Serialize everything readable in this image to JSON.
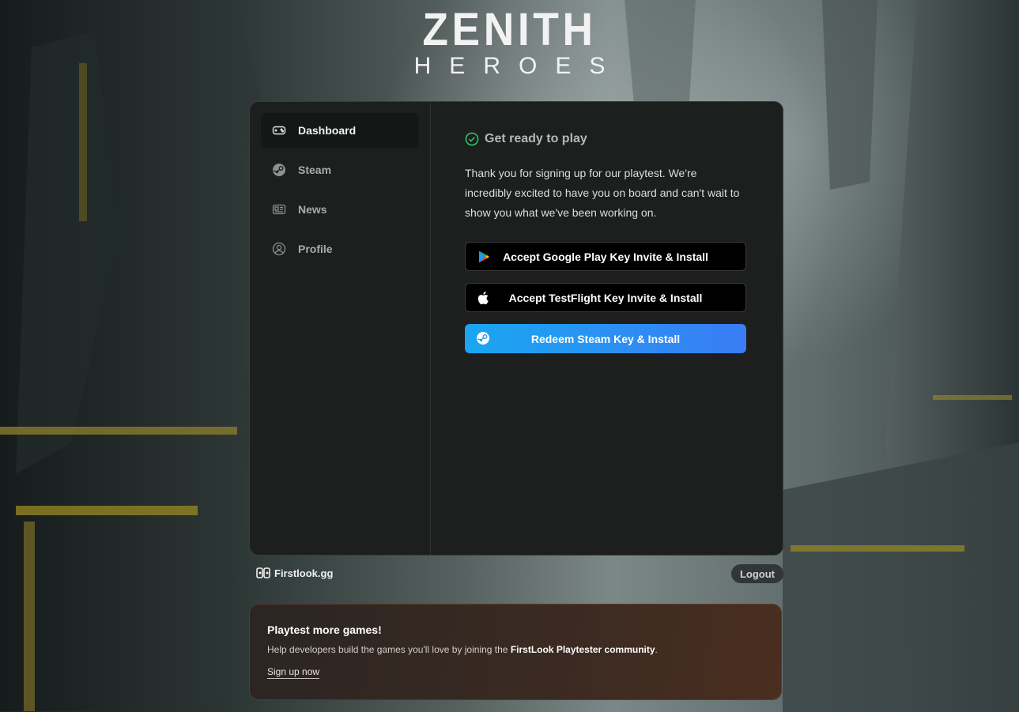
{
  "brand": {
    "title": "ZENITH",
    "subtitle": "HEROES"
  },
  "sidebar": {
    "items": [
      {
        "label": "Dashboard",
        "icon": "gamepad-icon"
      },
      {
        "label": "Steam",
        "icon": "steam-icon"
      },
      {
        "label": "News",
        "icon": "news-icon"
      },
      {
        "label": "Profile",
        "icon": "user-circle-icon"
      }
    ]
  },
  "main": {
    "heading": "Get ready to play",
    "intro": "Thank you for signing up for our playtest. We're incredibly excited to have you on board and can't wait to show you what we've been working on.",
    "buttons": [
      {
        "label": "Accept Google Play Key Invite & Install",
        "icon": "google-play-icon"
      },
      {
        "label": "Accept TestFlight Key Invite & Install",
        "icon": "apple-icon"
      },
      {
        "label": "Redeem Steam Key & Install",
        "icon": "steam-icon"
      }
    ]
  },
  "footer": {
    "logo_text": "Firstlook.gg",
    "logout_label": "Logout"
  },
  "promo": {
    "title": "Playtest more games!",
    "body_prefix": "Help developers build the games you'll love by joining the ",
    "body_bold": "FirstLook Playtester community",
    "body_suffix": ".",
    "link": "Sign up now"
  },
  "colors": {
    "accent_blue": "#3a7cf5",
    "check_green": "#2fbf6a",
    "panel_bg": "#1d1e1e"
  }
}
